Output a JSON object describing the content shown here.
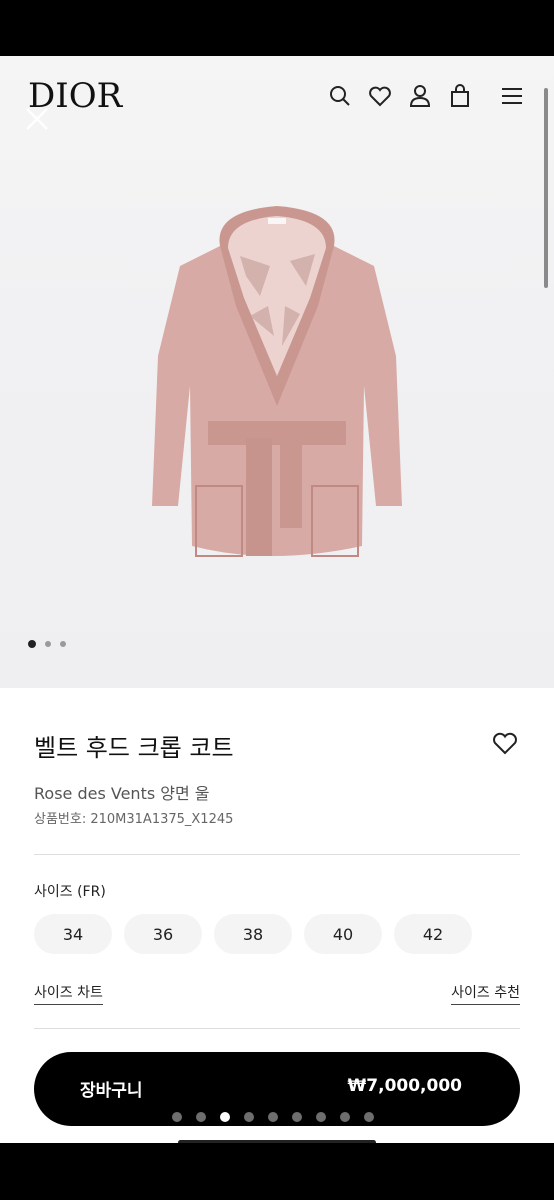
{
  "header": {
    "logo": "DIOR",
    "icons": [
      "search-icon",
      "heart-icon",
      "account-icon",
      "bag-icon",
      "menu-icon"
    ]
  },
  "gallery": {
    "image_count": 3,
    "active_index": 0
  },
  "product": {
    "title": "벨트 후드 크롭 코트",
    "subtitle": "Rose des Vents 양면 울",
    "sku": "상품번호: 210M31A1375_X1245"
  },
  "size": {
    "label": "사이즈 (FR)",
    "options": [
      "34",
      "36",
      "38",
      "40",
      "42"
    ],
    "chart_link": "사이즈 차트",
    "recommend_link": "사이즈 추천"
  },
  "cart": {
    "label": "장바구니",
    "price": "₩7,000,000"
  },
  "pager": {
    "count": 9,
    "active_index": 2
  },
  "colors": {
    "coat": "#d8aaa5",
    "coat_shade": "#c9978f",
    "lining": "#ecd3cf"
  }
}
